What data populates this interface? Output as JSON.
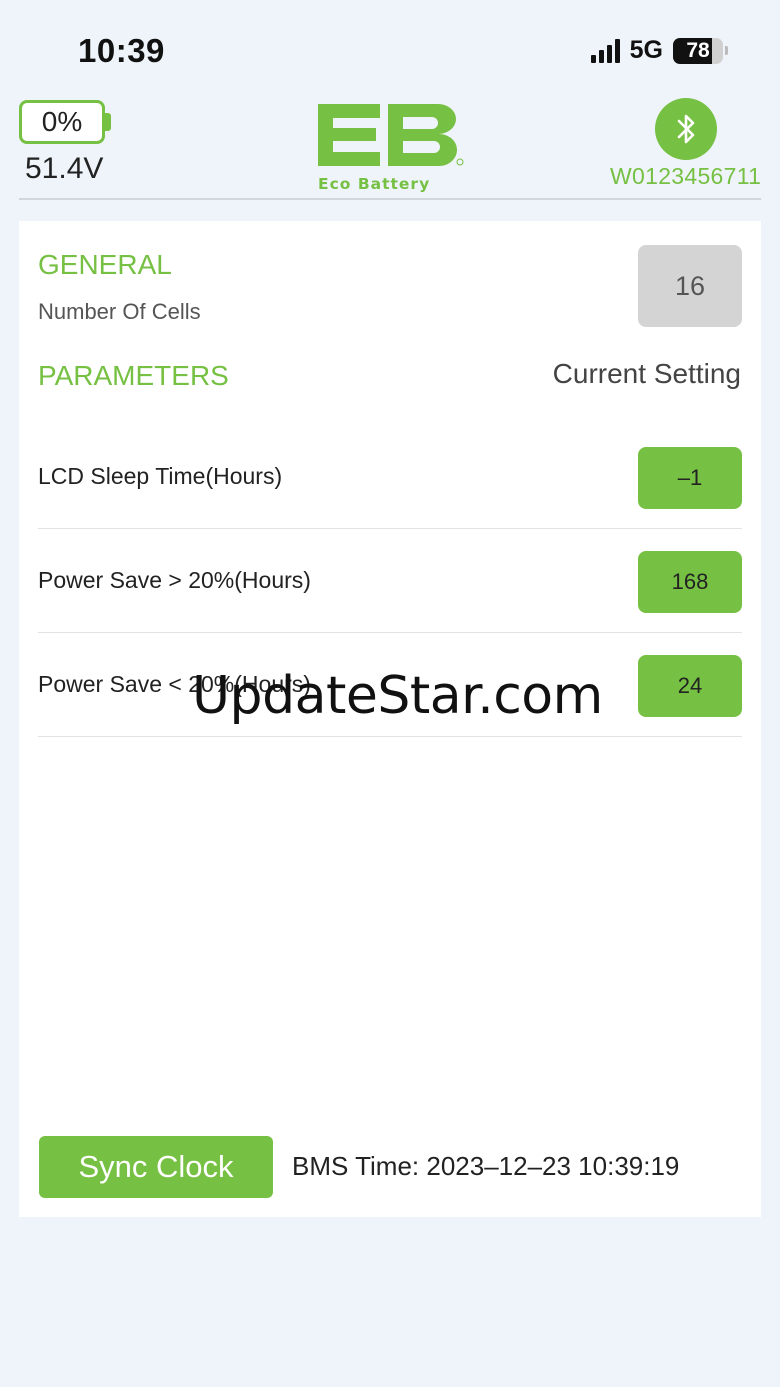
{
  "status_bar": {
    "time": "10:39",
    "network": "5G",
    "battery_level": 78,
    "battery_text": "78"
  },
  "header": {
    "battery_percent": "0%",
    "voltage": "51.4V",
    "logo_letters": "EB",
    "logo_text": "Eco Battery",
    "device_id": "W0123456711"
  },
  "general": {
    "title": "GENERAL",
    "cells_label": "Number Of Cells",
    "cells_value": "16"
  },
  "parameters": {
    "title": "PARAMETERS",
    "column_header": "Current Setting",
    "rows": [
      {
        "label": "LCD Sleep Time(Hours)",
        "value": "–1"
      },
      {
        "label": "Power Save > 20%(Hours)",
        "value": "168"
      },
      {
        "label": "Power Save < 20%(Hours)",
        "value": "24"
      }
    ]
  },
  "footer": {
    "sync_button": "Sync Clock",
    "bms_time": "BMS Time: 2023–12–23 10:39:19"
  },
  "watermark": "UpdateStar.com",
  "colors": {
    "accent": "#76c043",
    "background": "#eef4f9",
    "card": "#ffffff",
    "disabled_box": "#d4d4d4"
  },
  "icons": [
    "signal-bars-icon",
    "phone-battery-icon",
    "battery-icon",
    "bluetooth-icon",
    "eco-battery-logo"
  ]
}
